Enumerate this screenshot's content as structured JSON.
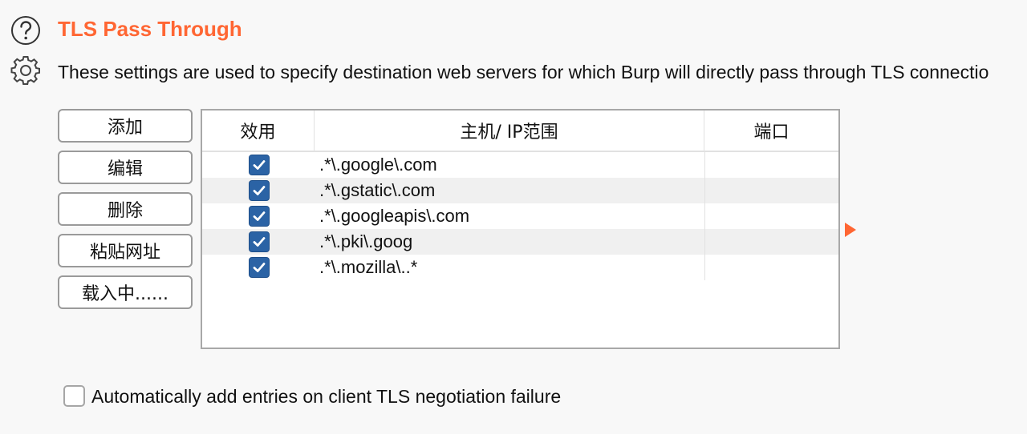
{
  "section": {
    "title": "TLS Pass Through",
    "description": "These settings are used to specify destination web servers for which Burp will directly pass through TLS connectio"
  },
  "icons": {
    "help": "help-circle-icon",
    "settings": "gear-icon",
    "expand": "triangle-right-icon"
  },
  "colors": {
    "accent": "#ff6633",
    "checkbox": "#2b63a5"
  },
  "buttons": {
    "add": "添加",
    "edit": "编辑",
    "remove": "删除",
    "paste_url": "粘贴网址",
    "load": "载入中......"
  },
  "table": {
    "columns": [
      "效用",
      "主机/ IP范围",
      "端口"
    ],
    "rows": [
      {
        "enabled": true,
        "host": ".*\\.google\\.com",
        "port": ""
      },
      {
        "enabled": true,
        "host": ".*\\.gstatic\\.com",
        "port": ""
      },
      {
        "enabled": true,
        "host": ".*\\.googleapis\\.com",
        "port": ""
      },
      {
        "enabled": true,
        "host": ".*\\.pki\\.goog",
        "port": ""
      },
      {
        "enabled": true,
        "host": ".*\\.mozilla\\..*",
        "port": ""
      }
    ]
  },
  "auto_add": {
    "checked": false,
    "label": "Automatically add entries on client TLS negotiation failure"
  }
}
